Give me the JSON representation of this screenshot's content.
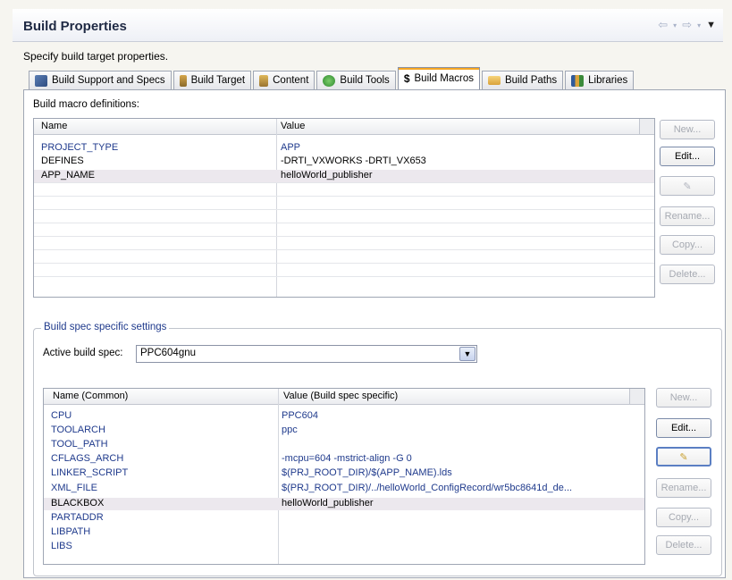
{
  "header": {
    "title": "Build Properties"
  },
  "description": "Specify build target properties.",
  "tabs": [
    {
      "label": "Build Support and Specs",
      "icon": "wrench-icon",
      "color": "#4a6fa5"
    },
    {
      "label": "Build Target",
      "icon": "target-icon",
      "color": "#c8a040"
    },
    {
      "label": "Content",
      "icon": "content-icon",
      "color": "#c8a040"
    },
    {
      "label": "Build Tools",
      "icon": "tools-icon",
      "color": "#3a9a3a"
    },
    {
      "label": "Build Macros",
      "icon": "dollar-icon",
      "color": "#000000"
    },
    {
      "label": "Build Paths",
      "icon": "folder-icon",
      "color": "#e6b84a"
    },
    {
      "label": "Libraries",
      "icon": "books-icon",
      "color": "#3a6aa0"
    }
  ],
  "macros": {
    "label": "Build macro definitions:",
    "col_name": "Name",
    "col_value": "Value",
    "rows": [
      {
        "name": "PROJECT_TYPE",
        "value": "APP"
      },
      {
        "name": "DEFINES",
        "value": "-DRTI_VXWORKS -DRTI_VX653"
      },
      {
        "name": "APP_NAME",
        "value": "helloWorld_publisher"
      }
    ],
    "buttons": {
      "new": "New...",
      "edit": "Edit...",
      "rename": "Rename...",
      "copy": "Copy...",
      "delete": "Delete..."
    }
  },
  "spec": {
    "legend": "Build spec specific settings",
    "active_label": "Active build spec:",
    "active_value": "PPC604gnu",
    "col_name": "Name (Common)",
    "col_value": "Value (Build spec specific)",
    "rows": [
      {
        "name": "CPU",
        "value": "PPC604"
      },
      {
        "name": "TOOLARCH",
        "value": "ppc"
      },
      {
        "name": "TOOL_PATH",
        "value": ""
      },
      {
        "name": "CFLAGS_ARCH",
        "value": "-mcpu=604 -mstrict-align -G 0"
      },
      {
        "name": "LINKER_SCRIPT",
        "value": "$(PRJ_ROOT_DIR)/$(APP_NAME).lds"
      },
      {
        "name": "XML_FILE",
        "value": "$(PRJ_ROOT_DIR)/../helloWorld_ConfigRecord/wr5bc8641d_de..."
      },
      {
        "name": "BLACKBOX",
        "value": "helloWorld_publisher"
      },
      {
        "name": "PARTADDR",
        "value": ""
      },
      {
        "name": "LIBPATH",
        "value": ""
      },
      {
        "name": "LIBS",
        "value": ""
      }
    ],
    "buttons": {
      "new": "New...",
      "edit": "Edit...",
      "rename": "Rename...",
      "copy": "Copy...",
      "delete": "Delete..."
    }
  },
  "colors": {
    "link": "#1f3a8c",
    "highlight": "#ece8ee",
    "tab_accent": "#f5a623"
  }
}
